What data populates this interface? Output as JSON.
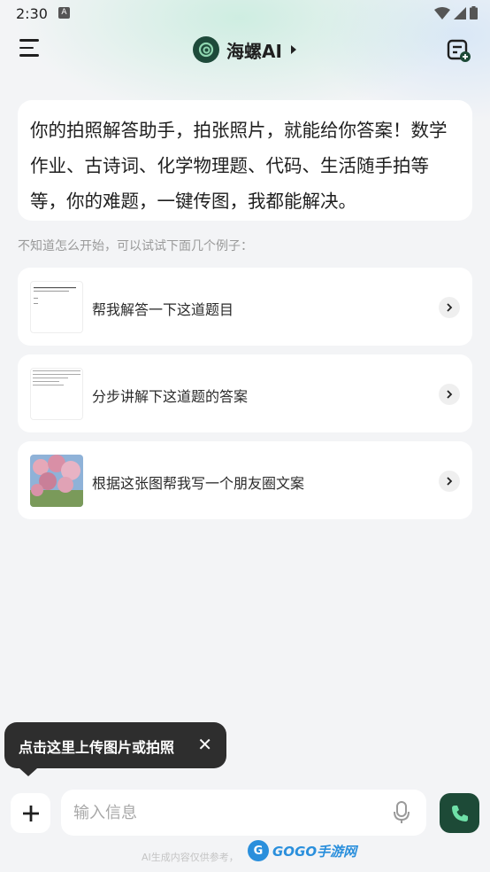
{
  "status_bar": {
    "time": "2:30",
    "notification_letter": "A"
  },
  "header": {
    "title": "海螺AI"
  },
  "intro": {
    "text": "你的拍照解答助手，拍张照片，就能给你答案！数学作业、古诗词、化学物理题、代码、生活随手拍等等，你的难题，一键传图，我都能解决。"
  },
  "hint": "不知道怎么开始，可以试试下面几个例子：",
  "examples": [
    {
      "label": "帮我解答一下这道题目",
      "thumb": "document-thumbnail"
    },
    {
      "label": "分步讲解下这道题的答案",
      "thumb": "document-thumbnail"
    },
    {
      "label": "根据这张图帮我写一个朋友圈文案",
      "thumb": "flower-photo"
    }
  ],
  "tooltip": {
    "text": "点击这里上传图片或拍照",
    "close": "✕"
  },
  "input": {
    "placeholder": "输入信息"
  },
  "footer": {
    "note": "AI生成内容仅供参考，",
    "watermark": "GOGO手游网"
  },
  "colors": {
    "accent": "#1d4a37",
    "background": "#f3f4f6"
  }
}
